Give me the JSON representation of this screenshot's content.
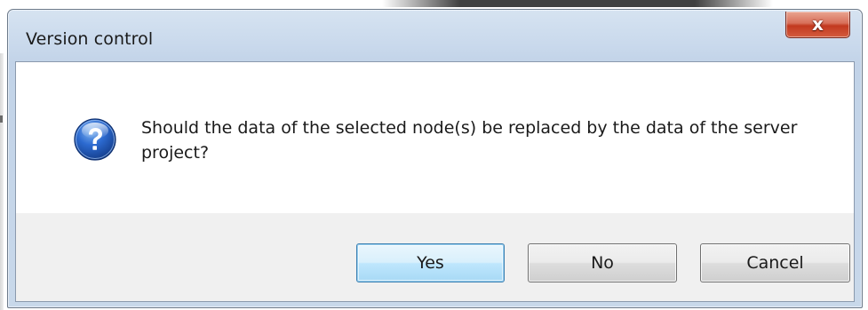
{
  "dialog": {
    "title": "Version control",
    "close_glyph": "x",
    "message": "Should the data of the selected node(s) be replaced by the data of the server project?",
    "icon": "question-icon"
  },
  "buttons": {
    "yes_label": "Yes",
    "no_label": "No",
    "cancel_label": "Cancel"
  },
  "colors": {
    "titlebar": "#c9d9ec",
    "close_button": "#c2391f",
    "default_button_accent": "#3c7fb1",
    "icon_blue": "#1f56b8"
  }
}
